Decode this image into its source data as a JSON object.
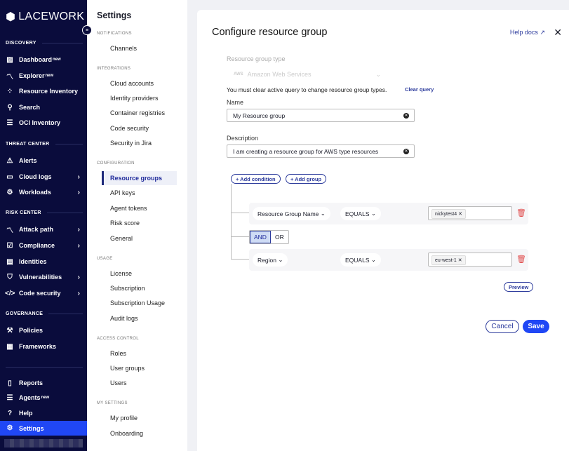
{
  "sidebar": {
    "brand": "LACEWORK",
    "sections": {
      "discovery": "DISCOVERY",
      "threat": "THREAT CENTER",
      "risk": "RISK CENTER",
      "governance": "GOVERNANCE"
    },
    "items": {
      "dashboard": {
        "label": "Dashboard",
        "badge": "new",
        "icon": "chart-icon"
      },
      "explorer": {
        "label": "Explorer",
        "badge": "new",
        "icon": "graph-icon"
      },
      "resource_inventory": {
        "label": "Resource Inventory",
        "icon": "grid-icon"
      },
      "search": {
        "label": "Search",
        "icon": "search-icon"
      },
      "oci": {
        "label": "OCI Inventory",
        "icon": "layers-icon"
      },
      "alerts": {
        "label": "Alerts",
        "icon": "alarm-icon"
      },
      "cloud_logs": {
        "label": "Cloud logs",
        "icon": "terminal-icon"
      },
      "workloads": {
        "label": "Workloads",
        "icon": "chip-icon"
      },
      "attack_path": {
        "label": "Attack path",
        "icon": "path-icon"
      },
      "compliance": {
        "label": "Compliance",
        "icon": "clipboard-check-icon"
      },
      "identities": {
        "label": "Identities",
        "icon": "id-card-icon"
      },
      "vulnerabilities": {
        "label": "Vulnerabilities",
        "icon": "shield-icon"
      },
      "code_security": {
        "label": "Code security",
        "icon": "code-icon"
      },
      "policies": {
        "label": "Policies",
        "icon": "gavel-icon"
      },
      "frameworks": {
        "label": "Frameworks",
        "icon": "clipboard-icon"
      },
      "reports": {
        "label": "Reports",
        "icon": "book-icon"
      },
      "agents": {
        "label": "Agents",
        "badge": "new",
        "icon": "layers-icon"
      },
      "help": {
        "label": "Help",
        "icon": "help-icon"
      },
      "settings": {
        "label": "Settings",
        "icon": "gear-icon"
      }
    }
  },
  "settings": {
    "title": "Settings",
    "groups": {
      "notifications": {
        "label": "NOTIFICATIONS",
        "items": [
          "Channels"
        ]
      },
      "integrations": {
        "label": "INTEGRATIONS",
        "items": [
          "Cloud accounts",
          "Identity providers",
          "Container registries",
          "Code security",
          "Security in Jira"
        ]
      },
      "configuration": {
        "label": "CONFIGURATION",
        "items": [
          "Resource groups",
          "API keys",
          "Agent tokens",
          "Risk score",
          "General"
        ]
      },
      "usage": {
        "label": "USAGE",
        "items": [
          "License",
          "Subscription",
          "Subscription Usage",
          "Audit logs"
        ]
      },
      "access": {
        "label": "ACCESS CONTROL",
        "items": [
          "Roles",
          "User groups",
          "Users"
        ]
      },
      "my": {
        "label": "MY SETTINGS",
        "items": [
          "My profile",
          "Onboarding"
        ]
      }
    },
    "active": "Resource groups"
  },
  "form": {
    "title": "Configure resource group",
    "help": "Help docs",
    "type_label": "Resource group type",
    "type_value": "Amazon Web Services",
    "type_logo": "aws",
    "notice": "You must clear active query to change resource group types.",
    "clear_query": "Clear query",
    "name_label": "Name",
    "name_value": "My Resource group",
    "desc_label": "Description",
    "desc_value": "I am creating a resource group for AWS type resources",
    "add_condition": "+ Add condition",
    "add_group": "+ Add group",
    "conditions": [
      {
        "field": "Resource Group Name",
        "operator": "EQUALS",
        "value": "nickytest4"
      },
      {
        "field": "Region",
        "operator": "EQUALS",
        "value": "eu-west-1"
      }
    ],
    "logic": {
      "and": "AND",
      "or": "OR",
      "selected": "AND"
    },
    "preview": "Preview",
    "cancel": "Cancel",
    "save": "Save"
  },
  "colors": {
    "sidebar": "#0a0c3c",
    "accent": "#2047f5",
    "link": "#2b3a9c",
    "danger": "#e04a4a"
  }
}
